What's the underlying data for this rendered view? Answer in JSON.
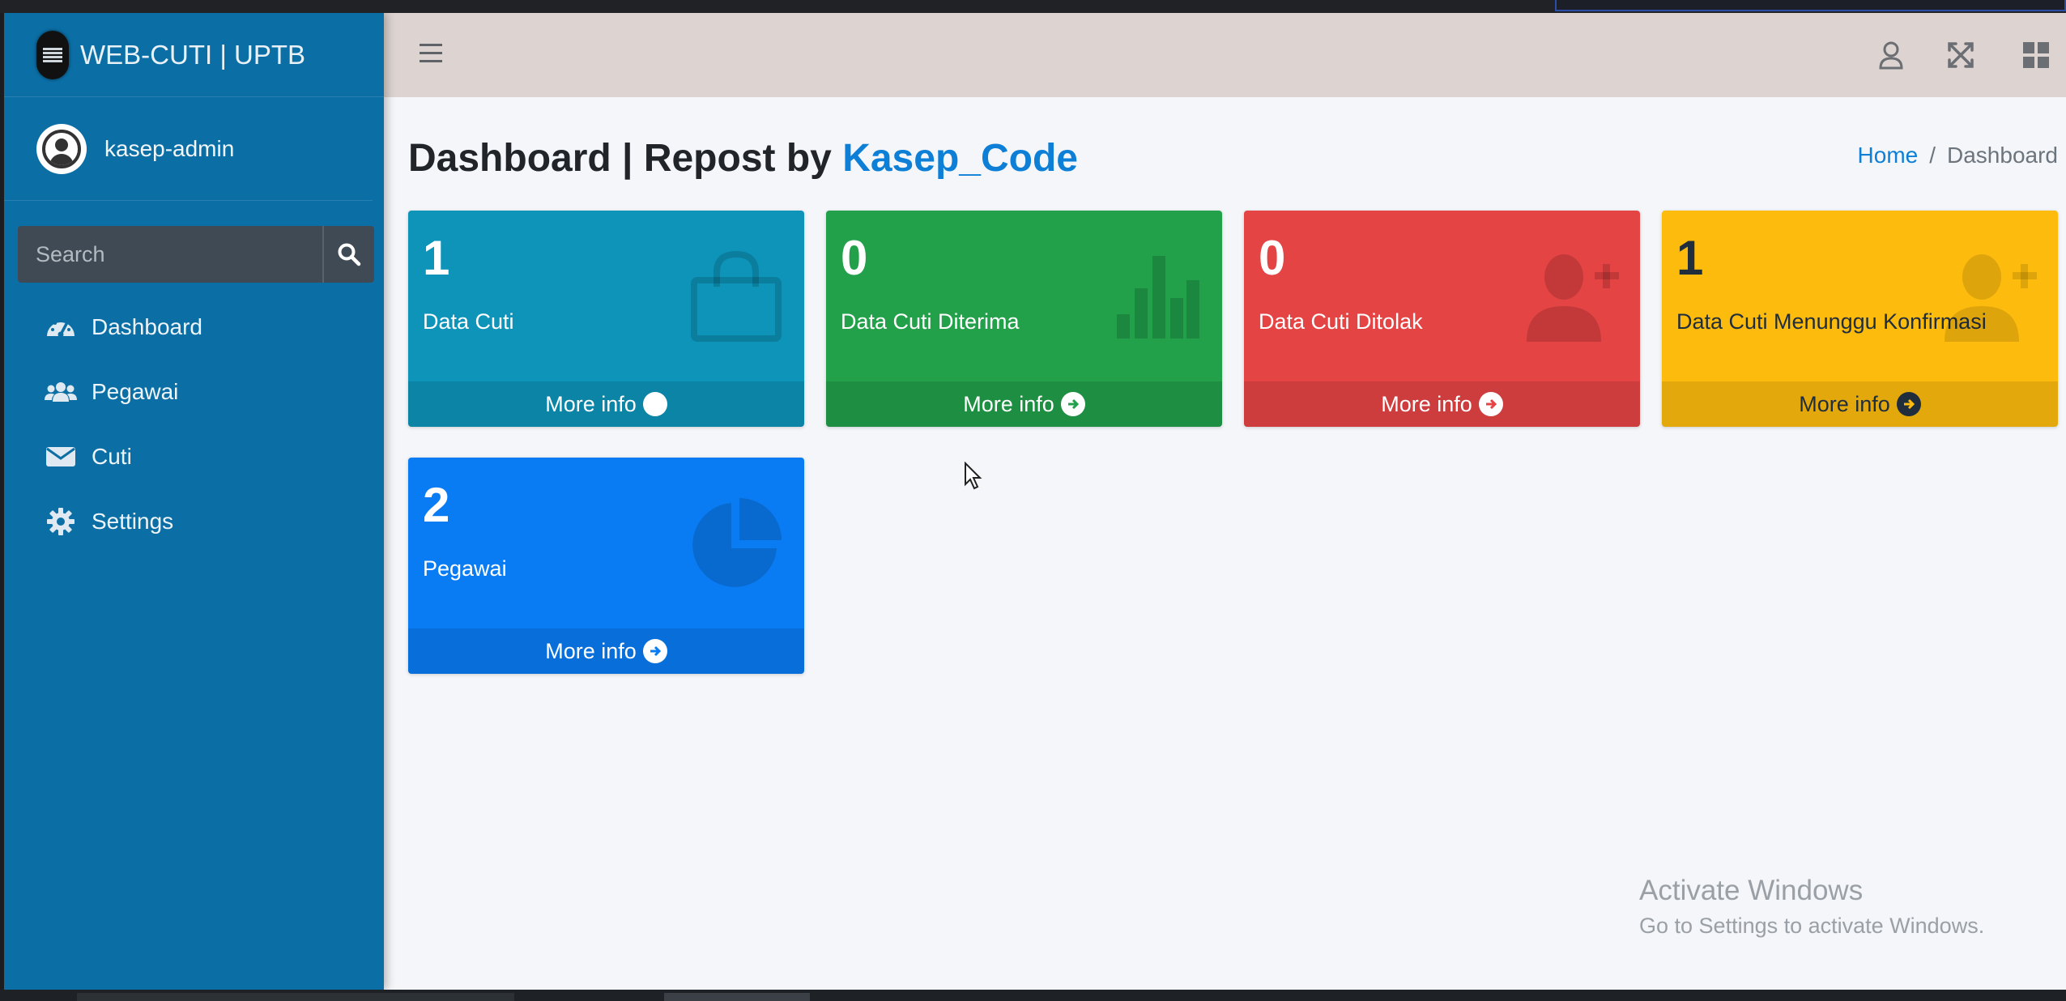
{
  "brand": {
    "title": "WEB-CUTI | UPTB"
  },
  "user": {
    "name": "kasep-admin"
  },
  "search": {
    "placeholder": "Search"
  },
  "sidebar": {
    "items": [
      {
        "label": "Dashboard",
        "icon": "tachometer-icon"
      },
      {
        "label": "Pegawai",
        "icon": "users-icon"
      },
      {
        "label": "Cuti",
        "icon": "envelope-icon"
      },
      {
        "label": "Settings",
        "icon": "gear-icon"
      }
    ]
  },
  "page": {
    "title_main": "Dashboard | Repost by ",
    "title_accent": "Kasep_Code"
  },
  "breadcrumb": {
    "home": "Home",
    "separator": "/",
    "current": "Dashboard"
  },
  "boxes": [
    {
      "value": "1",
      "label": "Data Cuti",
      "footer": "More info",
      "color": "#0e93b9",
      "icon": "shopping-bag-icon"
    },
    {
      "value": "0",
      "label": "Data Cuti Diterima",
      "footer": "More info",
      "color": "#22a04a",
      "icon": "bar-chart-icon"
    },
    {
      "value": "0",
      "label": "Data Cuti Ditolak",
      "footer": "More info",
      "color": "#e54444",
      "icon": "user-plus-icon"
    },
    {
      "value": "1",
      "label": "Data Cuti Menunggu Konfirmasi",
      "footer": "More info",
      "color": "#fdbb0d",
      "icon": "user-plus-icon"
    },
    {
      "value": "2",
      "label": "Pegawai",
      "footer": "More info",
      "color": "#0a7cf3",
      "icon": "pie-chart-icon"
    }
  ],
  "watermark": {
    "line1": "Activate Windows",
    "line2": "Go to Settings to activate Windows."
  }
}
